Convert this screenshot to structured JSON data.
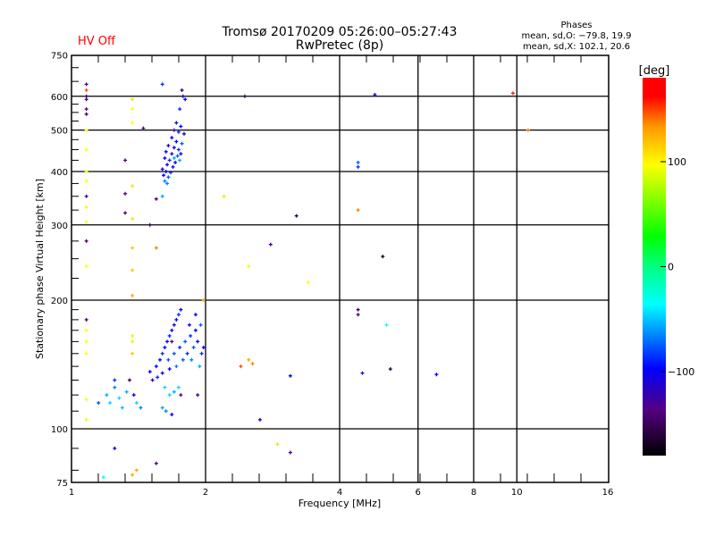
{
  "header": {
    "title_line1": "Tromsø 20170209 05:26:00–05:27:43",
    "title_line2": "RwPretec (8p)",
    "status": "HV Off",
    "status_color": "#ff0000",
    "stats_title": "Phases",
    "stats_o": "mean, sd,O: −79.8, 19.9",
    "stats_x": "mean, sd,X: 102.1, 20.6"
  },
  "chart_data": {
    "type": "scatter",
    "xlabel": "Frequency [MHz]",
    "ylabel": "Stationary phase Virtual Height [km]",
    "xscale": "log",
    "yscale": "log",
    "xlim": [
      1,
      16
    ],
    "ylim": [
      75,
      750
    ],
    "xticks": [
      "1",
      "2",
      "4",
      "6",
      "8",
      "10",
      "16"
    ],
    "xtick_values": [
      1,
      2,
      4,
      6,
      8,
      10,
      16
    ],
    "yticks": [
      "75",
      "100",
      "200",
      "300",
      "400",
      "500",
      "600",
      "750"
    ],
    "ytick_values": [
      75,
      100,
      200,
      300,
      400,
      500,
      600,
      750
    ],
    "grid_x": [
      2,
      4,
      6,
      8,
      10
    ],
    "grid_y": [
      100,
      200,
      300,
      400,
      500,
      600
    ],
    "colorbar": {
      "label": "[deg]",
      "range": [
        -180,
        180
      ],
      "ticks": [
        "100",
        "0",
        "−100"
      ],
      "tick_values": [
        100,
        0,
        -100
      ]
    },
    "point_fields": [
      "frequency_MHz",
      "height_km",
      "phase_deg"
    ],
    "points": [
      [
        1.08,
        640,
        -140
      ],
      [
        1.08,
        620,
        150
      ],
      [
        1.08,
        600,
        -150
      ],
      [
        1.08,
        590,
        -140
      ],
      [
        1.08,
        560,
        -140
      ],
      [
        1.08,
        545,
        -150
      ],
      [
        1.08,
        500,
        100
      ],
      [
        1.08,
        450,
        100
      ],
      [
        1.08,
        400,
        95
      ],
      [
        1.08,
        380,
        100
      ],
      [
        1.08,
        350,
        -140
      ],
      [
        1.08,
        330,
        95
      ],
      [
        1.08,
        305,
        100
      ],
      [
        1.08,
        275,
        -140
      ],
      [
        1.08,
        240,
        100
      ],
      [
        1.08,
        180,
        -140
      ],
      [
        1.08,
        170,
        100
      ],
      [
        1.08,
        160,
        100
      ],
      [
        1.08,
        150,
        100
      ],
      [
        1.08,
        117,
        100
      ],
      [
        1.08,
        105,
        95
      ],
      [
        1.37,
        590,
        110
      ],
      [
        1.37,
        560,
        100
      ],
      [
        1.37,
        520,
        100
      ],
      [
        1.37,
        370,
        110
      ],
      [
        1.37,
        310,
        110
      ],
      [
        1.37,
        265,
        120
      ],
      [
        1.37,
        235,
        120
      ],
      [
        1.37,
        205,
        130
      ],
      [
        1.37,
        165,
        90
      ],
      [
        1.37,
        160,
        90
      ],
      [
        1.37,
        150,
        120
      ],
      [
        1.37,
        78,
        130
      ],
      [
        1.32,
        320,
        -140
      ],
      [
        1.32,
        355,
        -140
      ],
      [
        1.32,
        425,
        -140
      ],
      [
        1.45,
        505,
        -140
      ],
      [
        1.5,
        300,
        -150
      ],
      [
        1.55,
        265,
        140
      ],
      [
        1.55,
        345,
        -150
      ],
      [
        1.6,
        640,
        -90
      ],
      [
        1.78,
        600,
        -110
      ],
      [
        1.8,
        590,
        -100
      ],
      [
        1.75,
        560,
        -90
      ],
      [
        1.72,
        520,
        -110
      ],
      [
        1.76,
        510,
        -100
      ],
      [
        1.7,
        500,
        -120
      ],
      [
        1.74,
        495,
        -90
      ],
      [
        1.79,
        490,
        -110
      ],
      [
        1.68,
        480,
        -100
      ],
      [
        1.72,
        470,
        -100
      ],
      [
        1.77,
        465,
        -80
      ],
      [
        1.65,
        460,
        -110
      ],
      [
        1.7,
        455,
        -100
      ],
      [
        1.74,
        450,
        -90
      ],
      [
        1.63,
        445,
        -100
      ],
      [
        1.68,
        440,
        -110
      ],
      [
        1.73,
        435,
        -80
      ],
      [
        1.76,
        440,
        -100
      ],
      [
        1.62,
        430,
        -100
      ],
      [
        1.66,
        425,
        -90
      ],
      [
        1.71,
        420,
        -100
      ],
      [
        1.64,
        415,
        -110
      ],
      [
        1.69,
        410,
        -100
      ],
      [
        1.6,
        405,
        -110
      ],
      [
        1.63,
        400,
        -100
      ],
      [
        1.67,
        398,
        -90
      ],
      [
        1.61,
        392,
        -100
      ],
      [
        1.65,
        388,
        -80
      ],
      [
        1.62,
        380,
        -70
      ],
      [
        1.64,
        375,
        -70
      ],
      [
        1.7,
        430,
        -60
      ],
      [
        1.75,
        425,
        -60
      ],
      [
        1.6,
        350,
        -60
      ],
      [
        1.77,
        620,
        -150
      ],
      [
        1.55,
        140,
        -100
      ],
      [
        1.58,
        145,
        -110
      ],
      [
        1.6,
        150,
        -90
      ],
      [
        1.62,
        155,
        -100
      ],
      [
        1.64,
        160,
        -110
      ],
      [
        1.66,
        165,
        -90
      ],
      [
        1.68,
        170,
        -100
      ],
      [
        1.7,
        175,
        -110
      ],
      [
        1.72,
        180,
        -100
      ],
      [
        1.74,
        185,
        -90
      ],
      [
        1.76,
        190,
        -100
      ],
      [
        1.65,
        145,
        -80
      ],
      [
        1.7,
        150,
        -80
      ],
      [
        1.75,
        155,
        -90
      ],
      [
        1.8,
        160,
        -80
      ],
      [
        1.85,
        165,
        -90
      ],
      [
        1.9,
        170,
        -100
      ],
      [
        1.95,
        175,
        -80
      ],
      [
        1.82,
        150,
        -90
      ],
      [
        1.88,
        155,
        -80
      ],
      [
        1.92,
        160,
        -100
      ],
      [
        1.96,
        150,
        -90
      ],
      [
        1.78,
        145,
        -80
      ],
      [
        1.72,
        140,
        -70
      ],
      [
        1.66,
        138,
        -100
      ],
      [
        1.6,
        135,
        -110
      ],
      [
        1.56,
        132,
        -90
      ],
      [
        1.52,
        130,
        -120
      ],
      [
        1.5,
        136,
        -100
      ],
      [
        1.86,
        145,
        -70
      ],
      [
        1.94,
        140,
        -60
      ],
      [
        1.98,
        155,
        -100
      ],
      [
        1.84,
        175,
        -110
      ],
      [
        1.9,
        185,
        -100
      ],
      [
        1.68,
        160,
        -140
      ],
      [
        1.62,
        125,
        -50
      ],
      [
        1.66,
        120,
        -50
      ],
      [
        1.7,
        122,
        -60
      ],
      [
        1.74,
        125,
        -50
      ],
      [
        1.6,
        112,
        -60
      ],
      [
        1.63,
        110,
        -70
      ],
      [
        1.68,
        108,
        -100
      ],
      [
        1.76,
        120,
        -140
      ],
      [
        1.92,
        120,
        -140
      ],
      [
        1.98,
        200,
        130
      ],
      [
        1.2,
        120,
        -60
      ],
      [
        1.22,
        115,
        -50
      ],
      [
        1.25,
        125,
        -70
      ],
      [
        1.28,
        118,
        -50
      ],
      [
        1.3,
        112,
        -55
      ],
      [
        1.33,
        122,
        -60
      ],
      [
        1.35,
        130,
        -150
      ],
      [
        1.38,
        120,
        -100
      ],
      [
        1.4,
        115,
        -50
      ],
      [
        1.43,
        112,
        -70
      ],
      [
        1.25,
        130,
        -90
      ],
      [
        1.15,
        115,
        -80
      ],
      [
        2.2,
        350,
        110
      ],
      [
        2.45,
        600,
        -150
      ],
      [
        2.5,
        240,
        100
      ],
      [
        2.4,
        140,
        150
      ],
      [
        2.55,
        142,
        140
      ],
      [
        2.5,
        145,
        130
      ],
      [
        2.8,
        270,
        -130
      ],
      [
        3.2,
        315,
        -160
      ],
      [
        3.1,
        133,
        -100
      ],
      [
        3.4,
        220,
        100
      ],
      [
        2.9,
        92,
        80
      ],
      [
        3.1,
        88,
        -130
      ],
      [
        4.4,
        420,
        -80
      ],
      [
        4.4,
        410,
        -90
      ],
      [
        4.4,
        325,
        140
      ],
      [
        4.4,
        190,
        -150
      ],
      [
        4.4,
        185,
        -140
      ],
      [
        4.5,
        135,
        -120
      ],
      [
        4.8,
        605,
        -110
      ],
      [
        5.0,
        253,
        -170
      ],
      [
        5.1,
        175,
        -40
      ],
      [
        5.2,
        138,
        -160
      ],
      [
        6.6,
        134,
        -100
      ],
      [
        9.8,
        610,
        160
      ],
      [
        10.6,
        500,
        140
      ],
      [
        2.65,
        105,
        -110
      ],
      [
        1.25,
        90,
        -110
      ],
      [
        1.55,
        83,
        -130
      ],
      [
        1.4,
        80,
        130
      ],
      [
        1.18,
        77,
        -40
      ]
    ]
  }
}
